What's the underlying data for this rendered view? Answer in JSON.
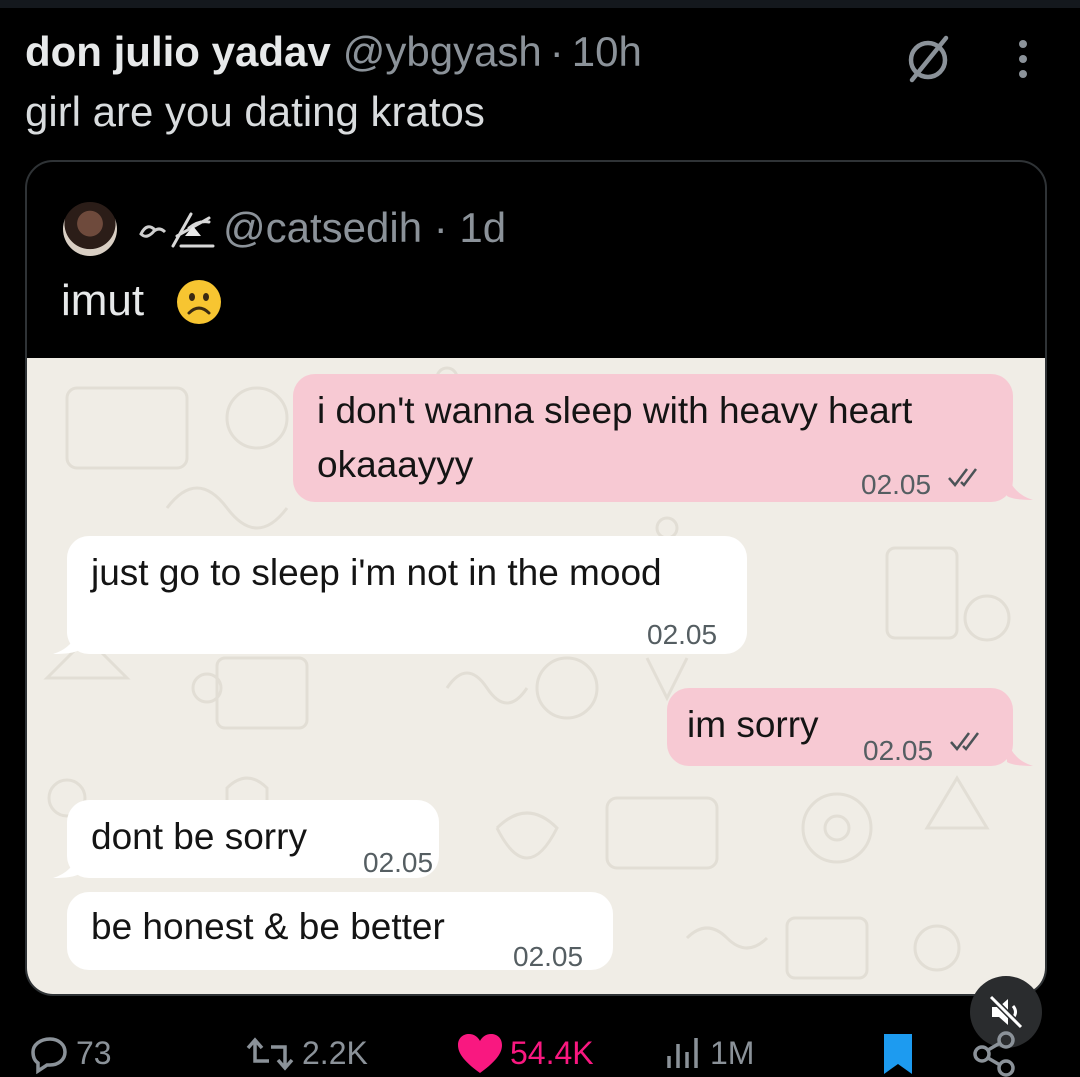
{
  "tweet": {
    "author_name": "don julio yadav",
    "author_handle": "@ybgyash",
    "separator": "·",
    "time": "10h",
    "text": "girl are you dating kratos"
  },
  "quote": {
    "handle": "@catsedih",
    "separator": "·",
    "time": "1d",
    "text": "imut",
    "emoji": "frowning-face-emoji"
  },
  "chat": {
    "messages": [
      {
        "direction": "outgoing",
        "text": "i don't wanna sleep with heavy heart okaaayyy",
        "line1": "i don't wanna sleep with heavy heart",
        "line2": "okaaayyy",
        "time": "02.05",
        "read": true
      },
      {
        "direction": "incoming",
        "text": "just go to sleep i'm not in the mood",
        "time": "02.05"
      },
      {
        "direction": "outgoing",
        "text": "im sorry",
        "time": "02.05",
        "read": true
      },
      {
        "direction": "incoming",
        "text": "dont be sorry",
        "time": "02.05"
      },
      {
        "direction": "incoming",
        "text": "be honest & be better",
        "time": "02.05"
      }
    ],
    "colors": {
      "outgoing": "#f7c9d3",
      "incoming": "#ffffff",
      "wallpaper": "#f0ede6"
    }
  },
  "actions": {
    "replies": "73",
    "reposts": "2.2K",
    "likes": "54.4K",
    "views": "1M"
  },
  "icons": [
    "grok-icon",
    "more-icon",
    "reply-icon",
    "repost-icon",
    "like-icon",
    "views-icon",
    "bookmark-icon",
    "share-icon",
    "mute-icon"
  ],
  "colors": {
    "background": "#000000",
    "like": "#f91880",
    "bookmark": "#1d9bf0",
    "muted_text": "#8b9299"
  }
}
